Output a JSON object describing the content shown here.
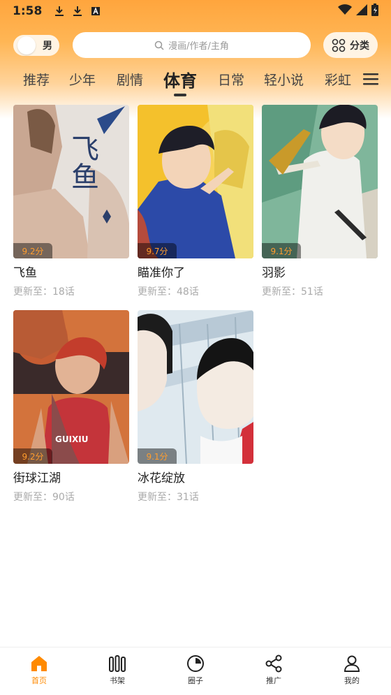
{
  "status_bar": {
    "time": "1:58"
  },
  "header": {
    "gender_label": "男",
    "search_placeholder": "漫画/作者/主角",
    "category_label": "分类"
  },
  "tabs": [
    "推荐",
    "少年",
    "剧情",
    "体育",
    "日常",
    "轻小说",
    "彩虹"
  ],
  "active_tab": "体育",
  "comics": [
    {
      "title": "飞鱼",
      "score": "9.2分",
      "update": "更新至：18话",
      "cover_text": "飞鱼"
    },
    {
      "title": "瞄准你了",
      "score": "9.7分",
      "update": "更新至：48话"
    },
    {
      "title": "羽影",
      "score": "9.1分",
      "update": "更新至：51话"
    },
    {
      "title": "街球江湖",
      "score": "9.2分",
      "update": "更新至：90话",
      "jersey_text": "GUIXIU"
    },
    {
      "title": "冰花绽放",
      "score": "9.1分",
      "update": "更新至：31话"
    }
  ],
  "bottom_nav": [
    {
      "label": "首页",
      "icon": "home-icon"
    },
    {
      "label": "书架",
      "icon": "bookshelf-icon"
    },
    {
      "label": "圈子",
      "icon": "circle-icon"
    },
    {
      "label": "推广",
      "icon": "share-icon"
    },
    {
      "label": "我的",
      "icon": "user-icon"
    }
  ],
  "colors": {
    "accent": "#ff8a00",
    "header_gradient_top": "#ffa53d"
  }
}
